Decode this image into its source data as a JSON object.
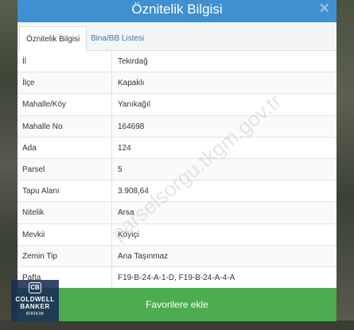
{
  "header": {
    "title": "Öznitelik Bilgisi",
    "close_icon": "close-icon",
    "menu_icon": "vertical-dots-icon"
  },
  "tabs": [
    {
      "label": "Öznitelik Bilgisi",
      "active": true
    },
    {
      "label": "Bina/BB Listesi",
      "active": false
    }
  ],
  "rows": [
    {
      "label": "İl",
      "value": "Tekirdağ"
    },
    {
      "label": "İlçe",
      "value": "Kapaklı"
    },
    {
      "label": "Mahalle/Köy",
      "value": "Yanıkağıl"
    },
    {
      "label": "Mahalle No",
      "value": "164698"
    },
    {
      "label": "Ada",
      "value": "124"
    },
    {
      "label": "Parsel",
      "value": "5"
    },
    {
      "label": "Tapu Alanı",
      "value": "3.908,64"
    },
    {
      "label": "Nitelik",
      "value": "Arsa"
    },
    {
      "label": "Mevkii",
      "value": "Köyiçi"
    },
    {
      "label": "Zemin Tip",
      "value": "Ana Taşınmaz"
    },
    {
      "label": "Pafta",
      "value": "F19-B-24-A-1-D, F19-B-24-A-4-A"
    }
  ],
  "watermark": "parselsorgu.tkgm.gov.tr",
  "favorite_button": {
    "label": "Favorilere ekle"
  },
  "logo": {
    "mark": "CB",
    "line1": "COLDWELL",
    "line2": "BANKER",
    "line3": "BİRİKİM"
  },
  "colors": {
    "header": "#3f90d0",
    "button": "#4cac4f",
    "link": "#3478b4"
  }
}
